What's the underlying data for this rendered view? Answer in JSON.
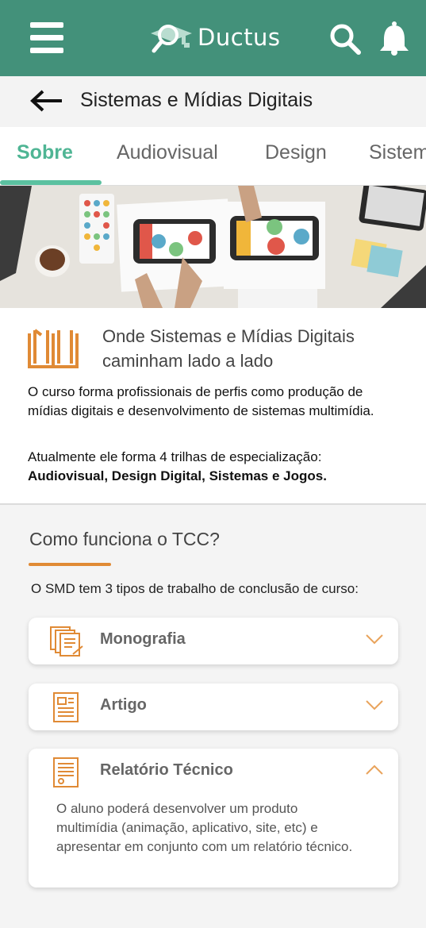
{
  "appbar": {
    "brand": "Ductus",
    "bg_color": "#43917a",
    "icons": [
      "menu-icon",
      "ductus-logo-icon",
      "search-icon",
      "bell-icon"
    ]
  },
  "titlebar": {
    "title": "Sistemas e Mídias Digitais"
  },
  "tabs": [
    {
      "label": "Sobre",
      "active": true
    },
    {
      "label": "Audiovisual",
      "active": false
    },
    {
      "label": "Design",
      "active": false
    },
    {
      "label": "Sistem",
      "active": false
    }
  ],
  "intro": {
    "title": "Onde Sistemas e Mídias Digitais caminham lado a lado",
    "paragraph1": "O curso forma profissionais de perfis como produção de mídias digitais e desenvolvimento de sistemas multimídia.",
    "paragraph2_lead": "Atualmente ele forma 4 trilhas de especialização:",
    "paragraph2_bold": "Audiovisual, Design Digital, Sistemas e Jogos."
  },
  "tcc": {
    "title": "Como funciona o TCC?",
    "description": "O SMD tem 3 tipos de trabalho de conclusão de curso:",
    "items": [
      {
        "label": "Monografia",
        "expanded": false,
        "icon": "documents-icon"
      },
      {
        "label": "Artigo",
        "expanded": false,
        "icon": "article-icon"
      },
      {
        "label": "Relatório Técnico",
        "expanded": true,
        "icon": "report-icon",
        "body": "O aluno poderá desenvolver um produto multimídia (animação, aplicativo, site, etc) e apresentar em conjunto com um relatório técnico."
      }
    ]
  },
  "colors": {
    "accent_green": "#5bc1a0",
    "accent_orange": "#e08a35"
  }
}
